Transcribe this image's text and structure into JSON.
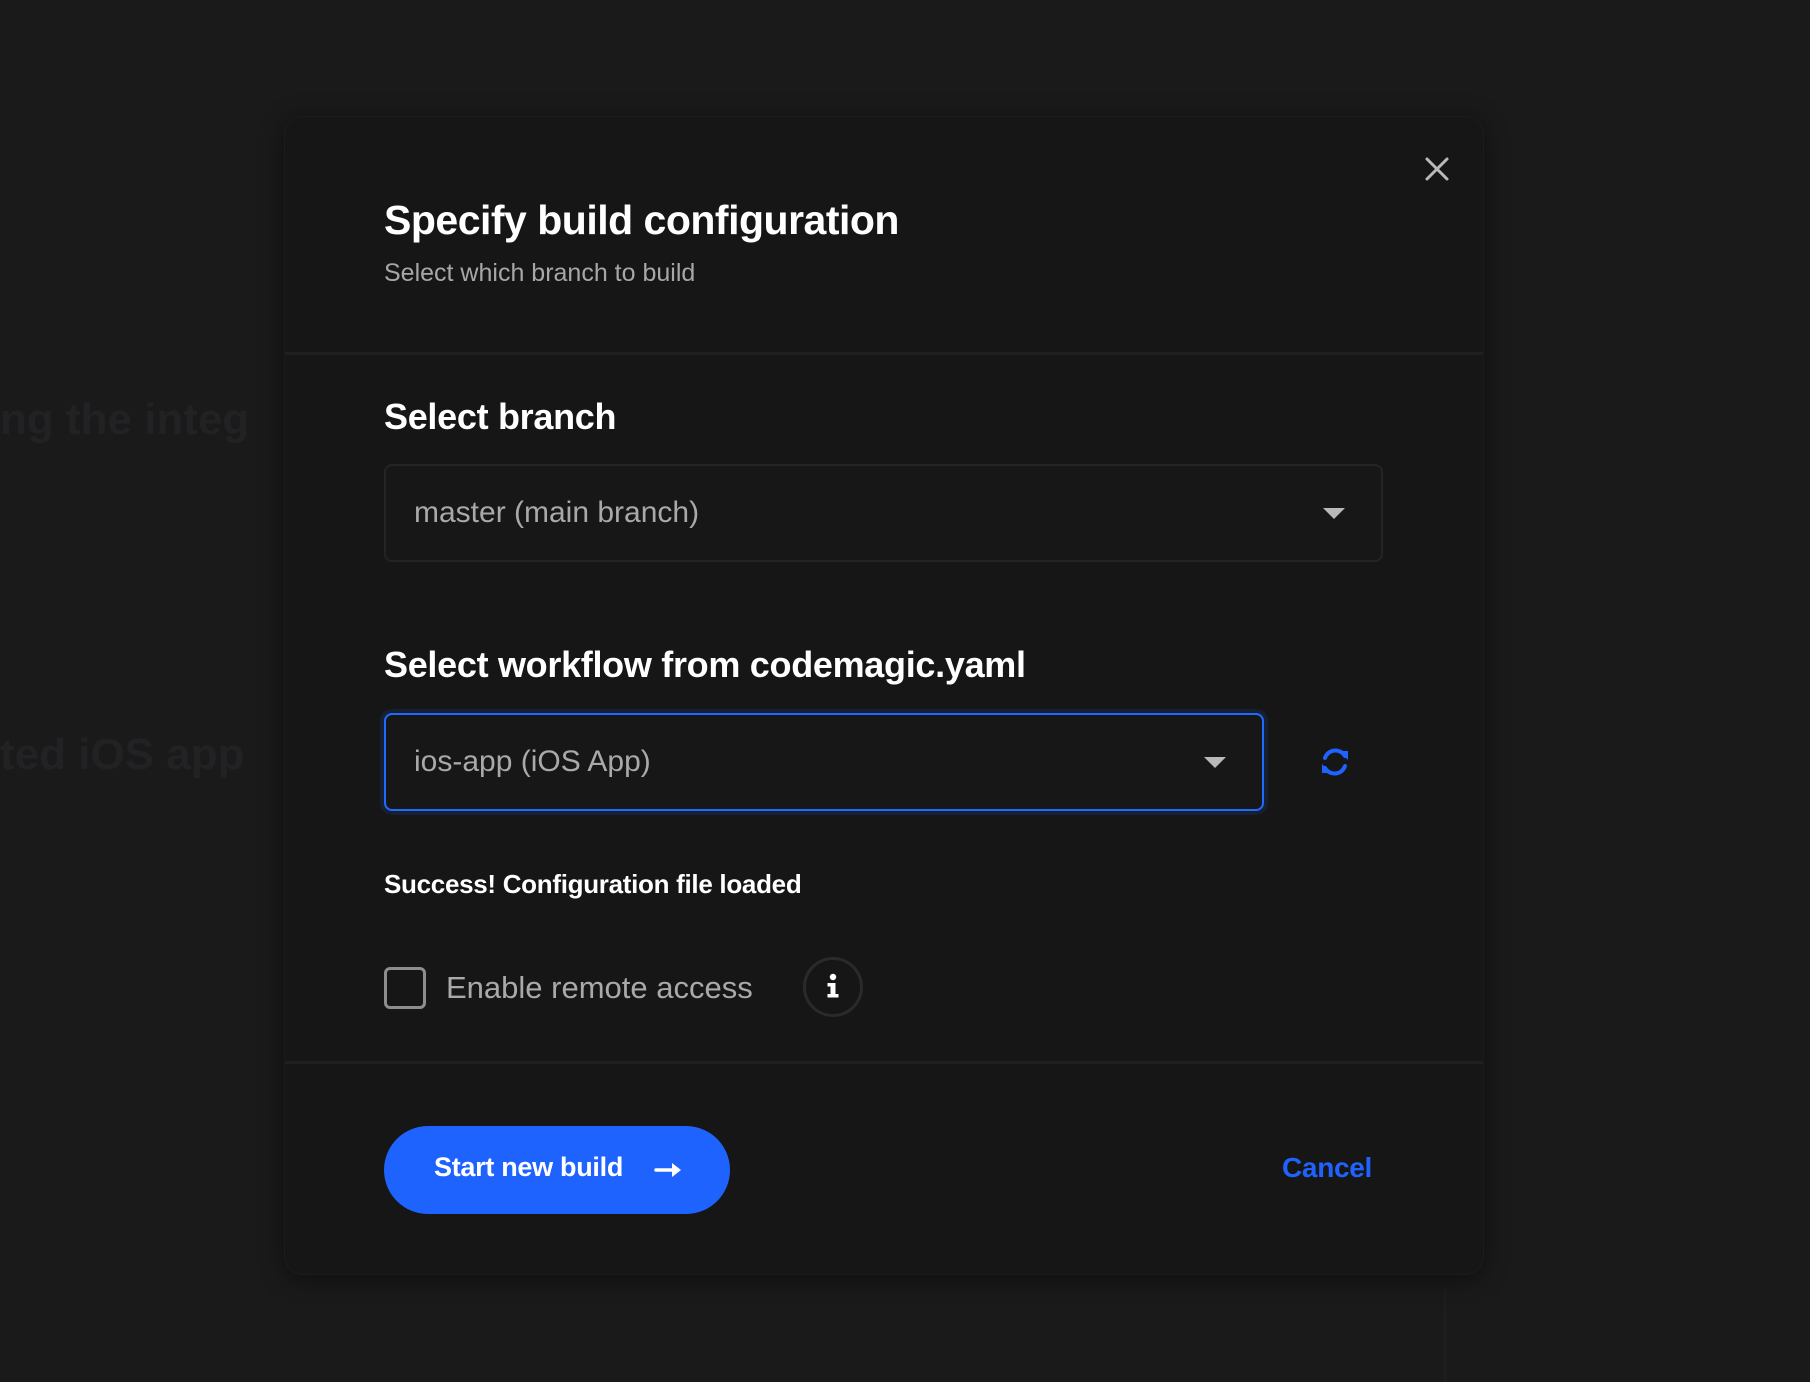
{
  "background": {
    "ghost_text_1": "ng the integ",
    "ghost_text_2": "ted iOS app"
  },
  "modal": {
    "title": "Specify build configuration",
    "subtitle": "Select which branch to build",
    "close_icon": "close-icon"
  },
  "branch": {
    "label": "Select branch",
    "selected": "master (main branch)"
  },
  "workflow": {
    "label": "Select workflow from codemagic.yaml",
    "selected": "ios-app (iOS App)",
    "refresh_icon": "refresh-icon"
  },
  "status": {
    "message": "Success! Configuration file loaded"
  },
  "remote_access": {
    "label": "Enable remote access",
    "checked": false,
    "info_icon": "info-icon"
  },
  "actions": {
    "start_label": "Start new build",
    "start_icon": "arrow-right-icon",
    "cancel_label": "Cancel"
  },
  "colors": {
    "accent": "#1f63ff",
    "background": "#1a1a1b",
    "modal": "#161617"
  }
}
